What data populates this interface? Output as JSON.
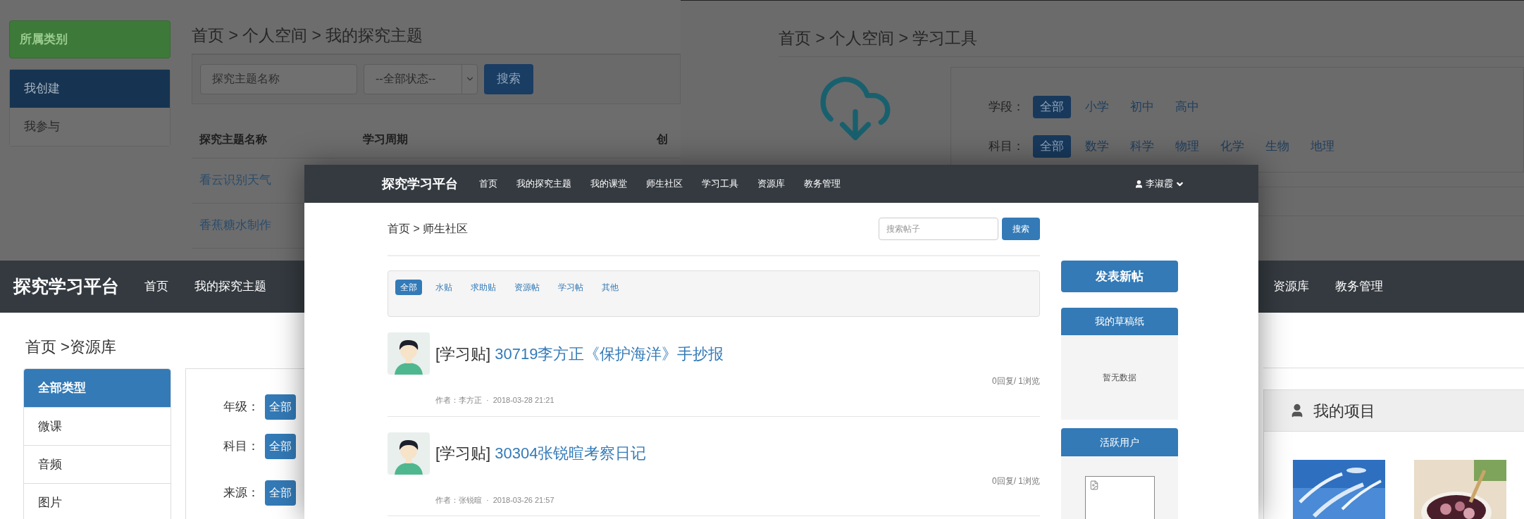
{
  "topic_window": {
    "sidebar": {
      "header": "所属类别",
      "items": [
        {
          "label": "我创建",
          "selected": true
        },
        {
          "label": "我参与",
          "selected": false
        }
      ]
    },
    "breadcrumb": "首页 > 个人空间 > 我的探究主题",
    "search": {
      "placeholder": "探究主题名称"
    },
    "status_select": {
      "value": "--全部状态--"
    },
    "search_button": "搜索",
    "table": {
      "columns": [
        "探究主题名称",
        "学习周期",
        "创"
      ],
      "rows": [
        [
          "看云识别天气"
        ],
        [
          "香蕉糖水制作"
        ]
      ]
    }
  },
  "tools_window": {
    "breadcrumb": "首页 > 个人空间 > 学习工具",
    "filters": [
      {
        "label": "学段：",
        "options": [
          {
            "label": "全部",
            "selected": true
          },
          {
            "label": "小学",
            "selected": false
          },
          {
            "label": "初中",
            "selected": false
          },
          {
            "label": "高中",
            "selected": false
          }
        ]
      },
      {
        "label": "科目：",
        "options": [
          {
            "label": "全部",
            "selected": true
          },
          {
            "label": "数学",
            "selected": false
          },
          {
            "label": "科学",
            "selected": false
          },
          {
            "label": "物理",
            "selected": false
          },
          {
            "label": "化学",
            "selected": false
          },
          {
            "label": "生物",
            "selected": false
          },
          {
            "label": "地理",
            "selected": false
          }
        ]
      }
    ]
  },
  "resource_window": {
    "brand": "探究学习平台",
    "nav_left": [
      "首页",
      "我的探究主题"
    ],
    "nav_right": [
      "资源库",
      "教务管理"
    ],
    "breadcrumb": "首页 >资源库",
    "types": [
      {
        "label": "全部类型",
        "selected": true
      },
      {
        "label": "微课",
        "selected": false
      },
      {
        "label": "音频",
        "selected": false
      },
      {
        "label": "图片",
        "selected": false
      }
    ],
    "filters": [
      {
        "label": "年级：",
        "options": [
          {
            "label": "全部",
            "selected": true
          }
        ]
      },
      {
        "label": "科目：",
        "options": [
          {
            "label": "全部",
            "selected": true
          }
        ]
      },
      {
        "label": "来源：",
        "options": [
          {
            "label": "全部",
            "selected": true
          }
        ]
      }
    ],
    "projects": {
      "title": "我的项目"
    }
  },
  "community_window": {
    "brand": "探究学习平台",
    "nav": [
      "首页",
      "我的探究主题",
      "我的课堂",
      "师生社区",
      "学习工具",
      "资源库",
      "教务管理"
    ],
    "user": "李淑霞",
    "breadcrumb": "首页 > 师生社区",
    "search": {
      "placeholder": "搜索帖子"
    },
    "search_button": "搜索",
    "tabs": [
      {
        "label": "全部",
        "selected": true
      },
      {
        "label": "水贴",
        "selected": false
      },
      {
        "label": "求助贴",
        "selected": false
      },
      {
        "label": "资源帖",
        "selected": false
      },
      {
        "label": "学习帖",
        "selected": false
      },
      {
        "label": "其他",
        "selected": false
      }
    ],
    "posts": [
      {
        "category": "[学习贴]",
        "title": "30719李方正《保护海洋》手抄报",
        "stats": "0回复/ 1浏览",
        "author_label": "作者：",
        "author": "李方正",
        "sep": "·",
        "time": "2018-03-28 21:21"
      },
      {
        "category": "[学习贴]",
        "title": "30304张锐暄考察日记",
        "stats": "0回复/ 1浏览",
        "author_label": "作者：",
        "author": "张锐暄",
        "sep": "·",
        "time": "2018-03-26 21:57"
      }
    ],
    "new_post_button": "发表新帖",
    "drafts": {
      "title": "我的草稿纸",
      "empty": "暂无数据"
    },
    "active_users": {
      "title": "活跃用户"
    }
  }
}
